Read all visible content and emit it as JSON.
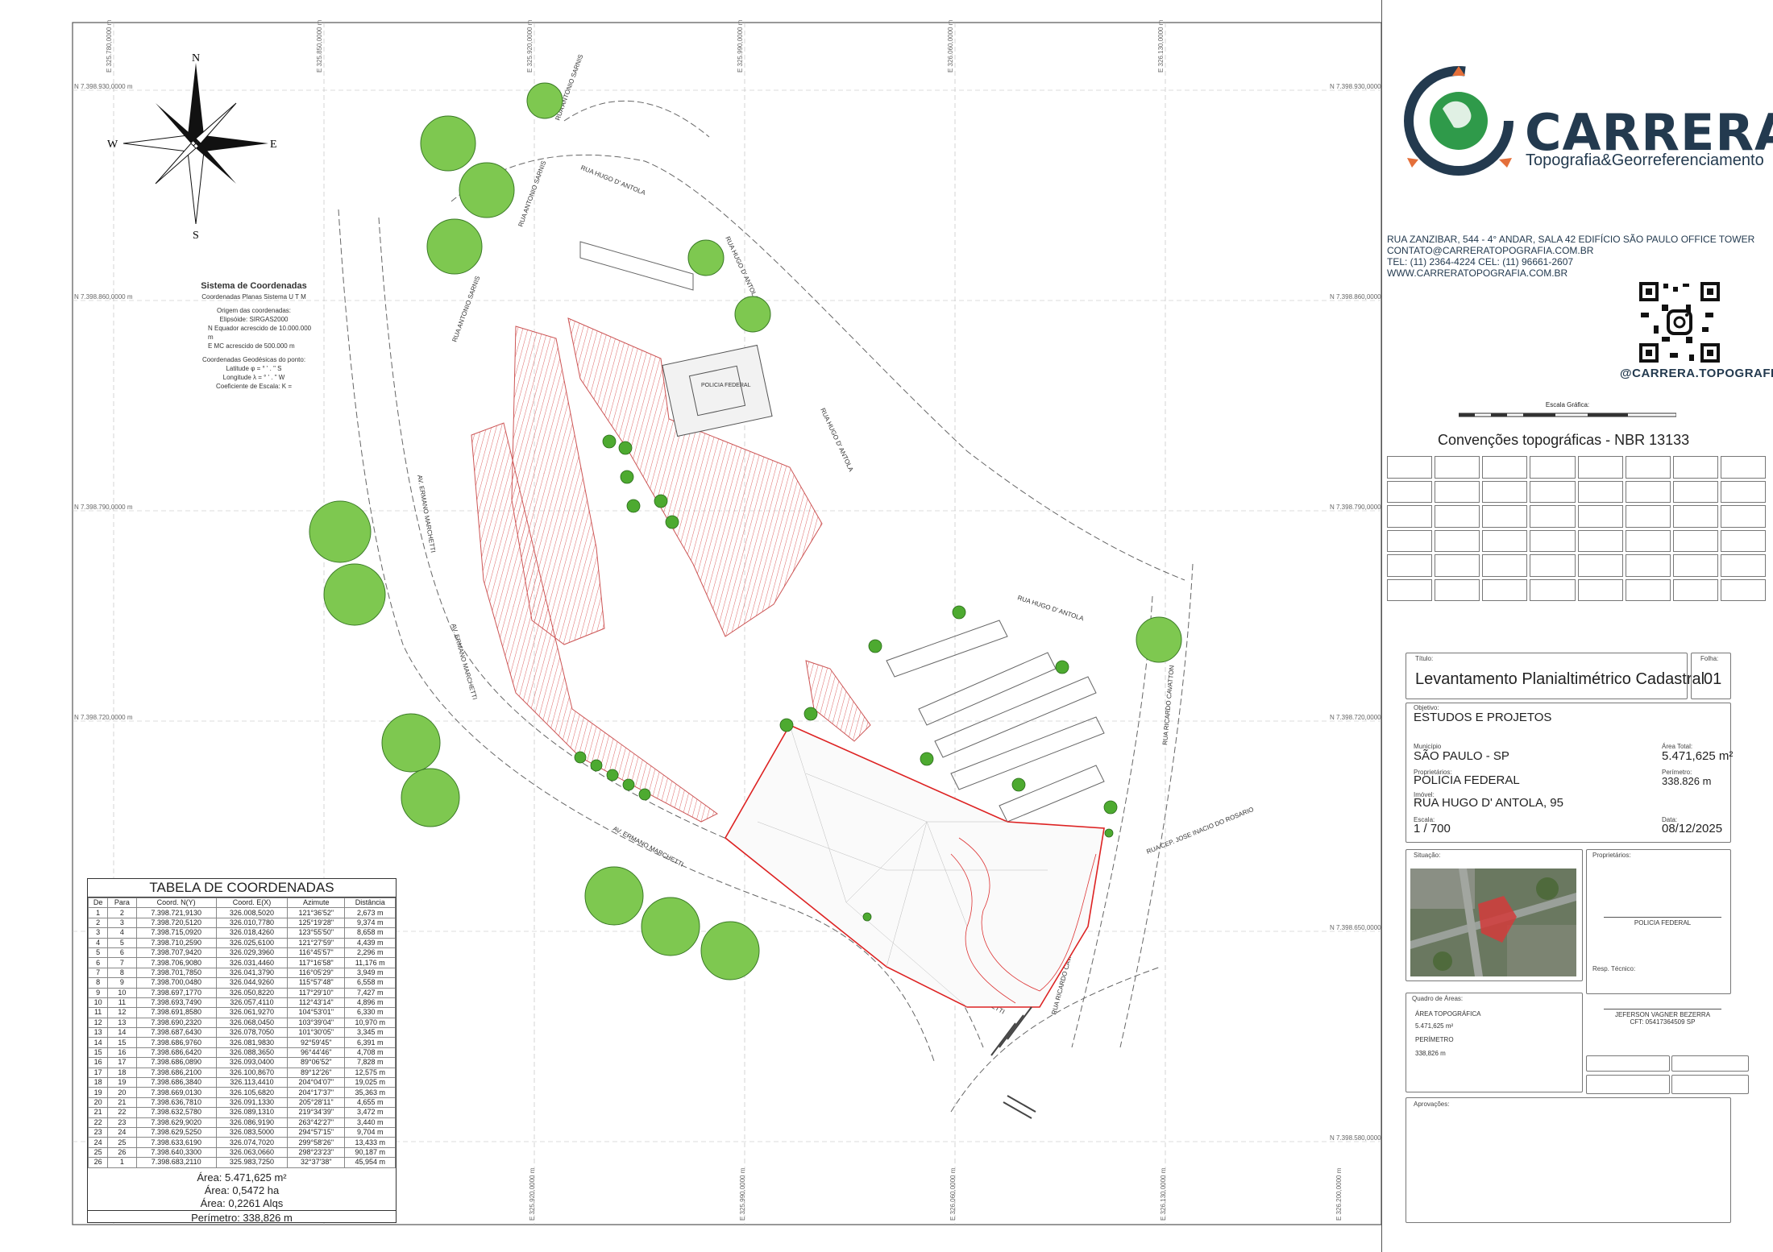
{
  "map": {
    "grid_n_labels": [
      "N 7.398.930,0000 m",
      "N 7.398.860,0000 m",
      "N 7.398.790,0000 m",
      "N 7.398.720,0000 m",
      "N 7.398.650,0000 m",
      "N 7.398.580,0000 m"
    ],
    "grid_e_labels": [
      "E 325.780,0000 m",
      "E 325.850,0000 m",
      "E 325.920,0000 m",
      "E 325.990,0000 m",
      "E 326.060,0000 m",
      "E 326.130,0000 m",
      "E 326.200,0000 m"
    ],
    "compass": {
      "n": "N",
      "s": "S",
      "e": "E",
      "w": "W"
    },
    "street_labels": {
      "antonio_sarnis_1": "RUA ANTONIO SARNIS",
      "antonio_sarnis_2": "RUA ANTONIO SARNIS",
      "antonio_sarnis_3": "RUA ANTONIO SARNIS",
      "hugo_antola_1": "RUA HUGO D' ANTOLA",
      "hugo_antola_2": "RUA HUGO D' ANTOLA",
      "hugo_antola_3": "RUA HUGO D' ANTOLA",
      "hugo_antola_4": "RUA HUGO D' ANTOLA",
      "ermano_1": "AV. ERMANO MARCHETTI",
      "ermano_2": "AV. ERMANO MARCHETTI",
      "ermano_3": "AV. ERMANO MARCHETTI",
      "ermano_4": "AV. ERMANO MARCHETTI",
      "ricardo_1": "RUA RICARDO CAVATTON",
      "ricardo_2": "RUA RICARDO CAVATTON",
      "jose_inacio": "RUA CEP. JOSE INACIO DO ROSARIO",
      "building": "POLICIA FEDERAL"
    },
    "coord_system": {
      "title": "Sistema de Coordenadas",
      "sub": "Coordenadas Planas Sistema U T M",
      "origem": "Origem das coordenadas:",
      "elipsoide": "Elipsóide:  SIRGAS2000",
      "n_eq": "N  Equador acrescido de 10.000.000 m",
      "e_mc": "E  MC              acrescido de 500.000 m",
      "geo": "Coordenadas Geodésicas do ponto:",
      "lat": "Latitude  φ =    °  '  .  \" S",
      "lon": "Longitude  λ =    °  '  .  \" W",
      "coef": "Coeficiente de Escala:  K ="
    }
  },
  "table": {
    "title": "TABELA DE COORDENADAS",
    "headers": [
      "De",
      "Para",
      "Coord. N(Y)",
      "Coord. E(X)",
      "Azimute",
      "Distância"
    ],
    "rows": [
      [
        "1",
        "2",
        "7.398.721,9130",
        "326.008,5020",
        "121°36'52\"",
        "2,673 m"
      ],
      [
        "2",
        "3",
        "7.398.720,5120",
        "326.010,7780",
        "125°19'28\"",
        "9,374 m"
      ],
      [
        "3",
        "4",
        "7.398.715,0920",
        "326.018,4260",
        "123°55'50\"",
        "8,658 m"
      ],
      [
        "4",
        "5",
        "7.398.710,2590",
        "326.025,6100",
        "121°27'59\"",
        "4,439 m"
      ],
      [
        "5",
        "6",
        "7.398.707,9420",
        "326.029,3960",
        "116°45'57\"",
        "2,296 m"
      ],
      [
        "6",
        "7",
        "7.398.706,9080",
        "326.031,4460",
        "117°16'58\"",
        "11,176 m"
      ],
      [
        "7",
        "8",
        "7.398.701,7850",
        "326.041,3790",
        "116°05'29\"",
        "3,949 m"
      ],
      [
        "8",
        "9",
        "7.398.700,0480",
        "326.044,9260",
        "115°57'48\"",
        "6,558 m"
      ],
      [
        "9",
        "10",
        "7.398.697,1770",
        "326.050,8220",
        "117°29'10\"",
        "7,427 m"
      ],
      [
        "10",
        "11",
        "7.398.693,7490",
        "326.057,4110",
        "112°43'14\"",
        "4,896 m"
      ],
      [
        "11",
        "12",
        "7.398.691,8580",
        "326.061,9270",
        "104°53'01\"",
        "6,330 m"
      ],
      [
        "12",
        "13",
        "7.398.690,2320",
        "326.068,0450",
        "103°39'04\"",
        "10,970 m"
      ],
      [
        "13",
        "14",
        "7.398.687,6430",
        "326.078,7050",
        "101°30'05\"",
        "3,345 m"
      ],
      [
        "14",
        "15",
        "7.398.686,9760",
        "326.081,9830",
        "92°59'45\"",
        "6,391 m"
      ],
      [
        "15",
        "16",
        "7.398.686,6420",
        "326.088,3650",
        "96°44'46\"",
        "4,708 m"
      ],
      [
        "16",
        "17",
        "7.398.686,0890",
        "326.093,0400",
        "89°06'52\"",
        "7,828 m"
      ],
      [
        "17",
        "18",
        "7.398.686,2100",
        "326.100,8670",
        "89°12'26\"",
        "12,575 m"
      ],
      [
        "18",
        "19",
        "7.398.686,3840",
        "326.113,4410",
        "204°04'07\"",
        "19,025 m"
      ],
      [
        "19",
        "20",
        "7.398.669,0130",
        "326.105,6820",
        "204°17'37\"",
        "35,363 m"
      ],
      [
        "20",
        "21",
        "7.398.636,7810",
        "326.091,1330",
        "205°28'11\"",
        "4,655 m"
      ],
      [
        "21",
        "22",
        "7.398.632,5780",
        "326.089,1310",
        "219°34'39\"",
        "3,472 m"
      ],
      [
        "22",
        "23",
        "7.398.629,9020",
        "326.086,9190",
        "263°42'27\"",
        "3,440 m"
      ],
      [
        "23",
        "24",
        "7.398.629,5250",
        "326.083,5000",
        "294°57'15\"",
        "9,704 m"
      ],
      [
        "24",
        "25",
        "7.398.633,6190",
        "326.074,7020",
        "299°58'26\"",
        "13,433 m"
      ],
      [
        "25",
        "26",
        "7.398.640,3300",
        "326.063,0660",
        "298°23'23\"",
        "90,187 m"
      ],
      [
        "26",
        "1",
        "7.398.683,2110",
        "325.983,7250",
        "32°37'38\"",
        "45,954 m"
      ]
    ],
    "area_m2": "Área: 5.471,625 m²",
    "area_ha": "Área: 0,5472 ha",
    "area_alqs": "Área: 0,2261 Alqs",
    "perimetro": "Perímetro: 338,826 m"
  },
  "brand": {
    "name": "CARRERA",
    "tagline": "Topografia&Georreferenciamento",
    "colors": {
      "navy": "#233a4f",
      "orange": "#e46f3a",
      "green": "#2f9a4a",
      "red": "#d43b3b"
    },
    "contact": [
      "RUA ZANZIBAR, 544 - 4° ANDAR, SALA 42  EDIFÍCIO SÃO PAULO OFFICE TOWER",
      "CONTATO@CARRERATOPOGRAFIA.COM.BR",
      "TEL: (11) 2364-4224  CEL: (11) 96661-2607",
      "WWW.CARRERATOPOGRAFIA.COM.BR"
    ],
    "instagram": "@CARRERA.TOPOGRAFIA"
  },
  "legend": {
    "escala_grafica": "Escala Gráfica:",
    "convencoes": "Convenções topográficas - NBR 13133"
  },
  "titleblock": {
    "titulo_label": "Título:",
    "titulo": "Levantamento Planialtimétrico Cadastral",
    "folha_label": "Folha:",
    "folha": "01",
    "objetivo_label": "Objetivo:",
    "objetivo": "ESTUDOS E PROJETOS",
    "municipio_label": "Município",
    "municipio": "SÃO PAULO - SP",
    "area_total_label": "Área Total:",
    "area_total": "5.471,625 m²",
    "proprietarios_label": "Proprietários:",
    "proprietarios": "POLICIA FEDERAL",
    "perimetro_label": "Perímetro:",
    "perimetro": "338.826 m",
    "imovel_label": "Imóvel:",
    "imovel": "RUA HUGO D' ANTOLA, 95",
    "escala_label": "Escala:",
    "escala": "1 / 700",
    "data_label": "Data:",
    "data": "08/12/2025",
    "situacao_label": "Situação:",
    "prop_label": "Proprietários:",
    "prop_sig": "POLICIA FEDERAL",
    "resp_label": "Resp. Técnico:",
    "resp_name": "JEFERSON VAGNER BEZERRA",
    "resp_cft": "CFT: 05417364509 SP",
    "quadro_label": "Quadro de Áreas:",
    "area_topo_label": "ÁREA TOPOGRÁFICA",
    "area_topo": "5.471,625 m²",
    "perim_label": "PERÍMETRO",
    "perim_val": "338,826 m",
    "aprov_label": "Aprovações:"
  }
}
